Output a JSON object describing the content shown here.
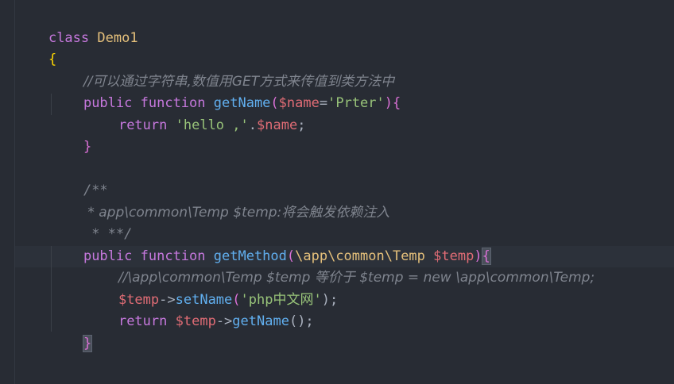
{
  "code": {
    "l1_kw": "class",
    "l1_name": "Demo1",
    "l2_brace": "{",
    "l3_comment": "//可以通过字符串,数值用GET方式来传值到类方法中",
    "l4_public": "public",
    "l4_function": "function",
    "l4_fname": "getName",
    "l4_open": "(",
    "l4_param": "$name",
    "l4_eq": "=",
    "l4_default": "'Prter'",
    "l4_close": ")",
    "l4_brace": "{",
    "l5_return": "return",
    "l5_str": "'hello ,'",
    "l5_dot": ".",
    "l5_var": "$name",
    "l5_semi": ";",
    "l6_brace": "}",
    "l8_doc": "/**",
    "l9_doc": " * app\\common\\Temp $temp:将会触发依赖注入",
    "l10_doc": " * **/",
    "l11_public": "public",
    "l11_function": "function",
    "l11_fname": "getMethod",
    "l11_open": "(",
    "l11_type": "\\app\\common\\Temp",
    "l11_param": "$temp",
    "l11_close": ")",
    "l11_brace": "{",
    "l12_comment": "//\\app\\common\\Temp $temp 等价于 $temp = new \\app\\common\\Temp;",
    "l13_var": "$temp",
    "l13_arrow": "->",
    "l13_method": "setName",
    "l13_open": "(",
    "l13_str": "'php中文网'",
    "l13_close": ");",
    "l14_return": "return",
    "l14_var": "$temp",
    "l14_arrow": "->",
    "l14_method": "getName",
    "l14_call": "();",
    "l15_brace": "}"
  },
  "colors": {
    "background": "#282c34",
    "keyword": "#c678dd",
    "function": "#61afef",
    "class": "#e5c07b",
    "variable": "#e06c75",
    "string": "#98c379",
    "comment": "#7f848e"
  }
}
